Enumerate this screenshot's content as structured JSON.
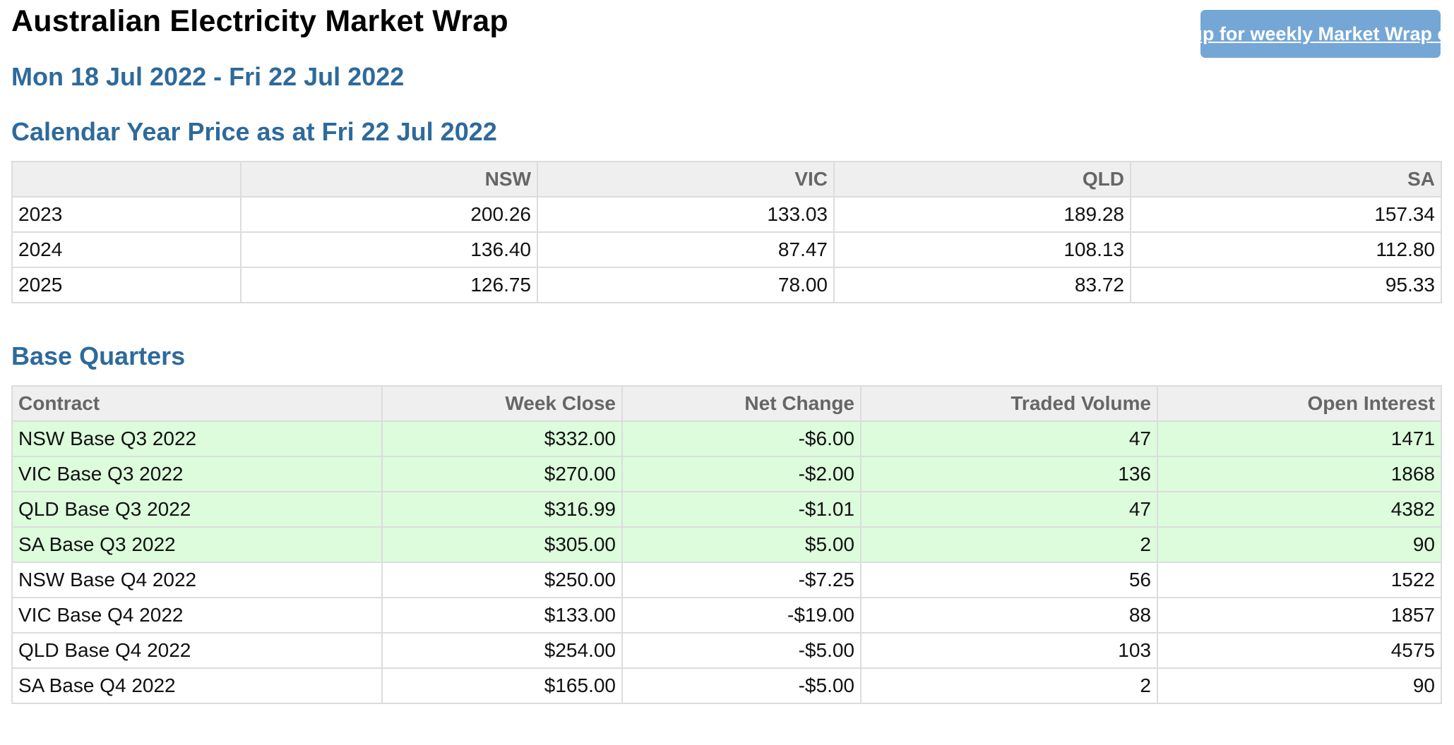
{
  "header": {
    "title": "Australian Electricity Market Wrap",
    "signup_label": "Sign up for weekly Market Wrap emails",
    "date_range": "Mon 18 Jul 2022 - Fri 22 Jul 2022"
  },
  "calendar": {
    "heading": "Calendar Year Price as at Fri 22 Jul 2022",
    "columns": [
      "",
      "NSW",
      "VIC",
      "QLD",
      "SA"
    ],
    "rows": [
      [
        "2023",
        "200.26",
        "133.03",
        "189.28",
        "157.34"
      ],
      [
        "2024",
        "136.40",
        "87.47",
        "108.13",
        "112.80"
      ],
      [
        "2025",
        "126.75",
        "78.00",
        "83.72",
        "95.33"
      ]
    ]
  },
  "quarters": {
    "heading": "Base Quarters",
    "columns": [
      "Contract",
      "Week Close",
      "Net Change",
      "Traded Volume",
      "Open Interest"
    ],
    "rows": [
      [
        "NSW Base Q3 2022",
        "$332.00",
        "-$6.00",
        "47",
        "1471"
      ],
      [
        "VIC Base Q3 2022",
        "$270.00",
        "-$2.00",
        "136",
        "1868"
      ],
      [
        "QLD Base Q3 2022",
        "$316.99",
        "-$1.01",
        "47",
        "4382"
      ],
      [
        "SA Base Q3 2022",
        "$305.00",
        "$5.00",
        "2",
        "90"
      ],
      [
        "NSW Base Q4 2022",
        "$250.00",
        "-$7.25",
        "56",
        "1522"
      ],
      [
        "VIC Base Q4 2022",
        "$133.00",
        "-$19.00",
        "88",
        "1857"
      ],
      [
        "QLD Base Q4 2022",
        "$254.00",
        "-$5.00",
        "103",
        "4575"
      ],
      [
        "SA Base Q4 2022",
        "$165.00",
        "-$5.00",
        "2",
        "90"
      ]
    ]
  },
  "colors": {
    "heading_blue": "#2e6a9b",
    "button_bg": "#74a7d5",
    "highlight_row": "#dcfcdc",
    "header_row": "#efefef"
  }
}
